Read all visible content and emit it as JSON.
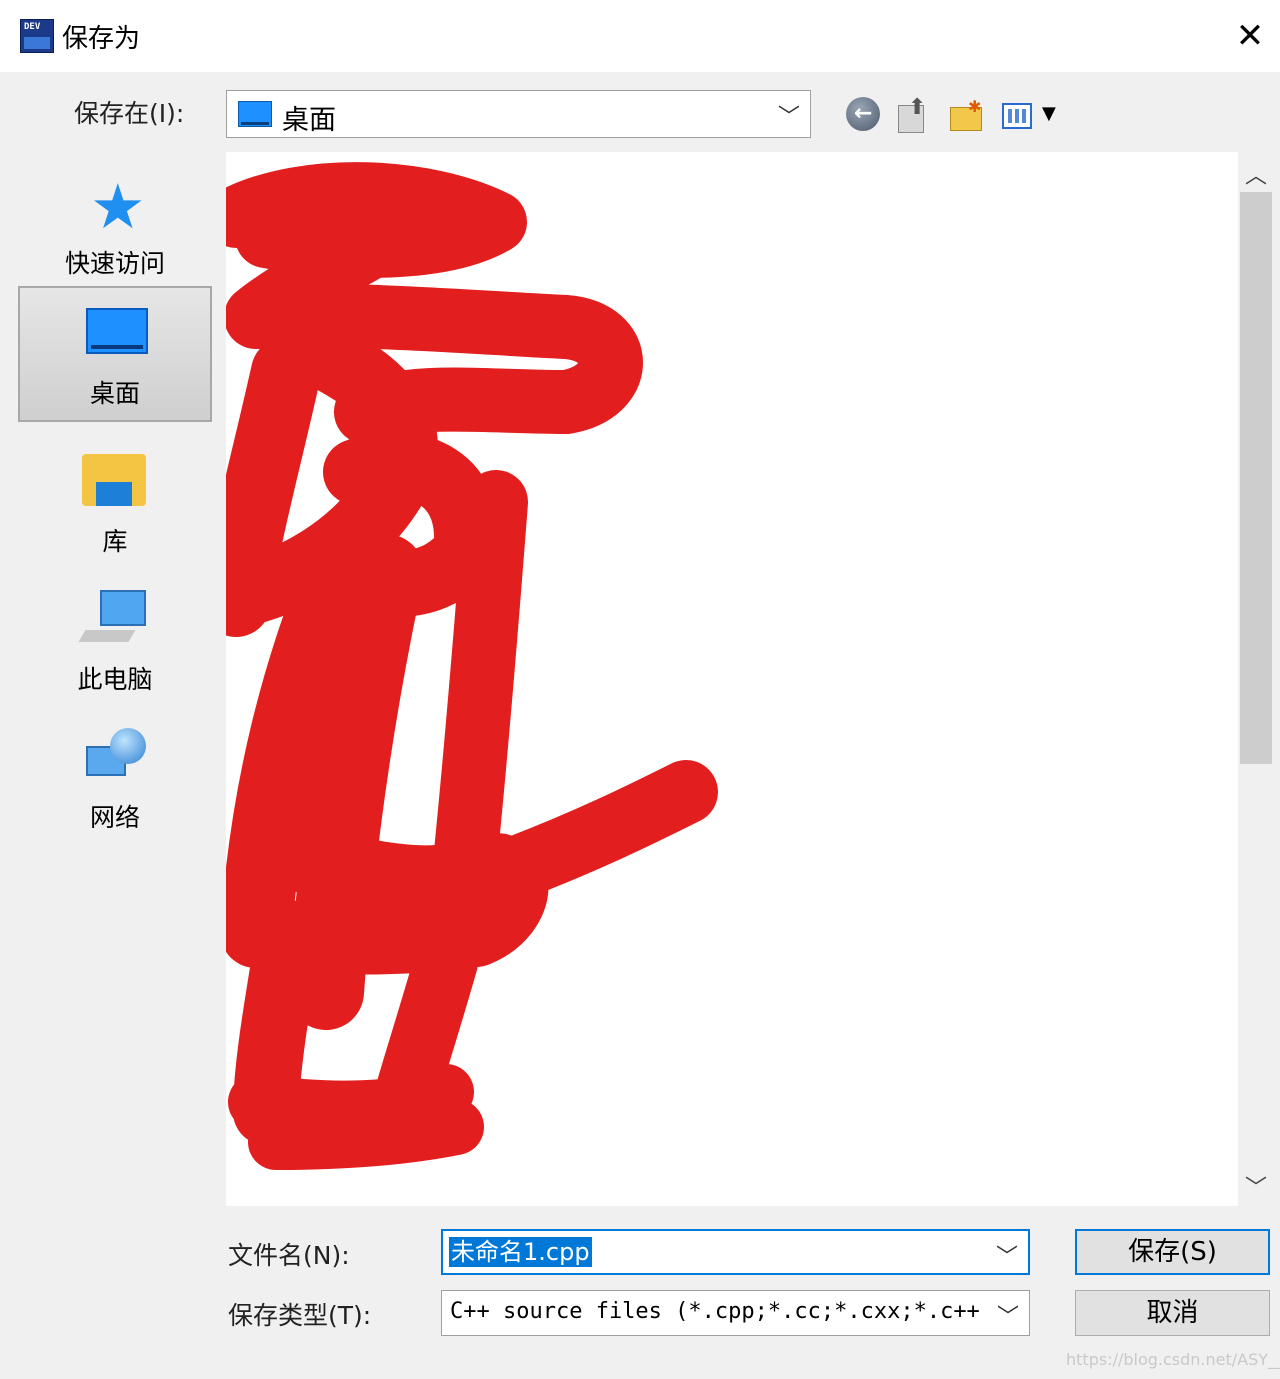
{
  "window": {
    "title": "保存为",
    "app_icon": "dev-cpp-icon",
    "close_symbol": "✕"
  },
  "look_in": {
    "label": "保存在(I):",
    "value": "桌面",
    "icon": "desktop-folder-icon"
  },
  "toolbar": {
    "back": "back-icon",
    "up": "up-folder-icon",
    "new_folder": "new-folder-icon",
    "view_menu": "view-menu-icon"
  },
  "places": [
    {
      "label": "快速访问",
      "icon": "quick-access-star-icon"
    },
    {
      "label": "桌面",
      "icon": "desktop-icon",
      "selected": true
    },
    {
      "label": "库",
      "icon": "libraries-icon"
    },
    {
      "label": "此电脑",
      "icon": "this-pc-icon"
    },
    {
      "label": "网络",
      "icon": "network-icon"
    }
  ],
  "file_list": {
    "redaction_color": "#e21e1e"
  },
  "file_name": {
    "label": "文件名(N):",
    "value": "未命名1.cpp"
  },
  "file_type": {
    "label": "保存类型(T):",
    "value": "C++ source files (*.cpp;*.cc;*.cxx;*.c++"
  },
  "buttons": {
    "save": "保存(S)",
    "cancel": "取消"
  },
  "watermark": "https://blog.csdn.net/ASY___",
  "colors": {
    "accent": "#0078d7",
    "titlebar": "#ffffff",
    "background": "#f0f0f0"
  }
}
